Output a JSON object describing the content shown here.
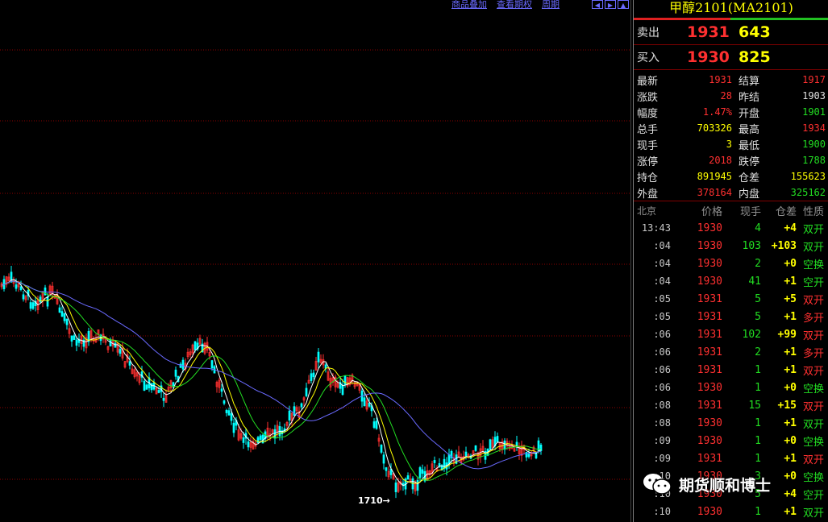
{
  "toolbar": {
    "link1": "商品叠加",
    "link2": "查看期权",
    "link3": "周期",
    "nav_icons": [
      "arrow-left-icon",
      "arrow-right-icon",
      "arrow-up-icon"
    ]
  },
  "chart": {
    "min_label": "1710→",
    "colors": {
      "up": "#ff3030",
      "down": "#00ffff",
      "ma_white": "#ffffff",
      "ma_yellow": "#ffff00",
      "ma_green": "#22dd22",
      "ma_blue": "#6a6aff",
      "grid": "#8b0000"
    }
  },
  "panel": {
    "title": "甲醇2101(MA2101)",
    "sell": {
      "label": "卖出",
      "price": "1931",
      "volume": "643"
    },
    "buy": {
      "label": "买入",
      "price": "1930",
      "volume": "825"
    },
    "stats": [
      {
        "k1": "最新",
        "v1": "1931",
        "c1": "#ff3030",
        "k2": "结算",
        "v2": "1917",
        "c2": "#ff3030"
      },
      {
        "k1": "涨跌",
        "v1": "28",
        "c1": "#ff3030",
        "k2": "昨结",
        "v2": "1903",
        "c2": "#e0e0e0"
      },
      {
        "k1": "幅度",
        "v1": "1.47%",
        "c1": "#ff3030",
        "k2": "开盘",
        "v2": "1901",
        "c2": "#22dd22"
      },
      {
        "k1": "总手",
        "v1": "703326",
        "c1": "#ffff00",
        "k2": "最高",
        "v2": "1934",
        "c2": "#ff3030"
      },
      {
        "k1": "现手",
        "v1": "3",
        "c1": "#ffff00",
        "k2": "最低",
        "v2": "1900",
        "c2": "#22dd22"
      },
      {
        "k1": "涨停",
        "v1": "2018",
        "c1": "#ff3030",
        "k2": "跌停",
        "v2": "1788",
        "c2": "#22dd22"
      },
      {
        "k1": "持仓",
        "v1": "891945",
        "c1": "#ffff00",
        "k2": "仓差",
        "v2": "155623",
        "c2": "#ffff00"
      },
      {
        "k1": "外盘",
        "v1": "378164",
        "c1": "#ff3030",
        "k2": "内盘",
        "v2": "325162",
        "c2": "#22dd22"
      }
    ],
    "ticks_header": {
      "time": "北京",
      "price": "价格",
      "vol": "现手",
      "oi": "仓差",
      "nature": "性质"
    },
    "ticks": [
      {
        "time": "13:43",
        "price": "1930",
        "vol": "4",
        "oi": "+4",
        "nature": "双开",
        "nat": "green"
      },
      {
        "time": ":04",
        "price": "1930",
        "vol": "103",
        "oi": "+103",
        "nature": "双开",
        "nat": "green"
      },
      {
        "time": ":04",
        "price": "1930",
        "vol": "2",
        "oi": "+0",
        "nature": "空换",
        "nat": "green"
      },
      {
        "time": ":04",
        "price": "1930",
        "vol": "41",
        "oi": "+1",
        "nature": "空开",
        "nat": "green"
      },
      {
        "time": ":05",
        "price": "1931",
        "vol": "5",
        "oi": "+5",
        "nature": "双开",
        "nat": "red"
      },
      {
        "time": ":05",
        "price": "1931",
        "vol": "5",
        "oi": "+1",
        "nature": "多开",
        "nat": "red"
      },
      {
        "time": ":06",
        "price": "1931",
        "vol": "102",
        "oi": "+99",
        "nature": "双开",
        "nat": "red"
      },
      {
        "time": ":06",
        "price": "1931",
        "vol": "2",
        "oi": "+1",
        "nature": "多开",
        "nat": "red"
      },
      {
        "time": ":06",
        "price": "1931",
        "vol": "1",
        "oi": "+1",
        "nature": "双开",
        "nat": "red"
      },
      {
        "time": ":06",
        "price": "1930",
        "vol": "1",
        "oi": "+0",
        "nature": "空换",
        "nat": "green"
      },
      {
        "time": ":08",
        "price": "1931",
        "vol": "15",
        "oi": "+15",
        "nature": "双开",
        "nat": "red"
      },
      {
        "time": ":08",
        "price": "1930",
        "vol": "1",
        "oi": "+1",
        "nature": "双开",
        "nat": "green"
      },
      {
        "time": ":09",
        "price": "1930",
        "vol": "1",
        "oi": "+0",
        "nature": "空换",
        "nat": "green"
      },
      {
        "time": ":09",
        "price": "1931",
        "vol": "1",
        "oi": "+1",
        "nature": "双开",
        "nat": "red"
      },
      {
        "time": ":10",
        "price": "1930",
        "vol": "3",
        "oi": "+0",
        "nature": "空换",
        "nat": "green"
      },
      {
        "time": ":10",
        "price": "1930",
        "vol": "5",
        "oi": "+4",
        "nature": "空开",
        "nat": "green"
      },
      {
        "time": ":10",
        "price": "1930",
        "vol": "1",
        "oi": "+1",
        "nature": "双开",
        "nat": "green"
      }
    ]
  },
  "watermark": {
    "text": "期货顺和博士",
    "icon": "wechat-icon"
  }
}
